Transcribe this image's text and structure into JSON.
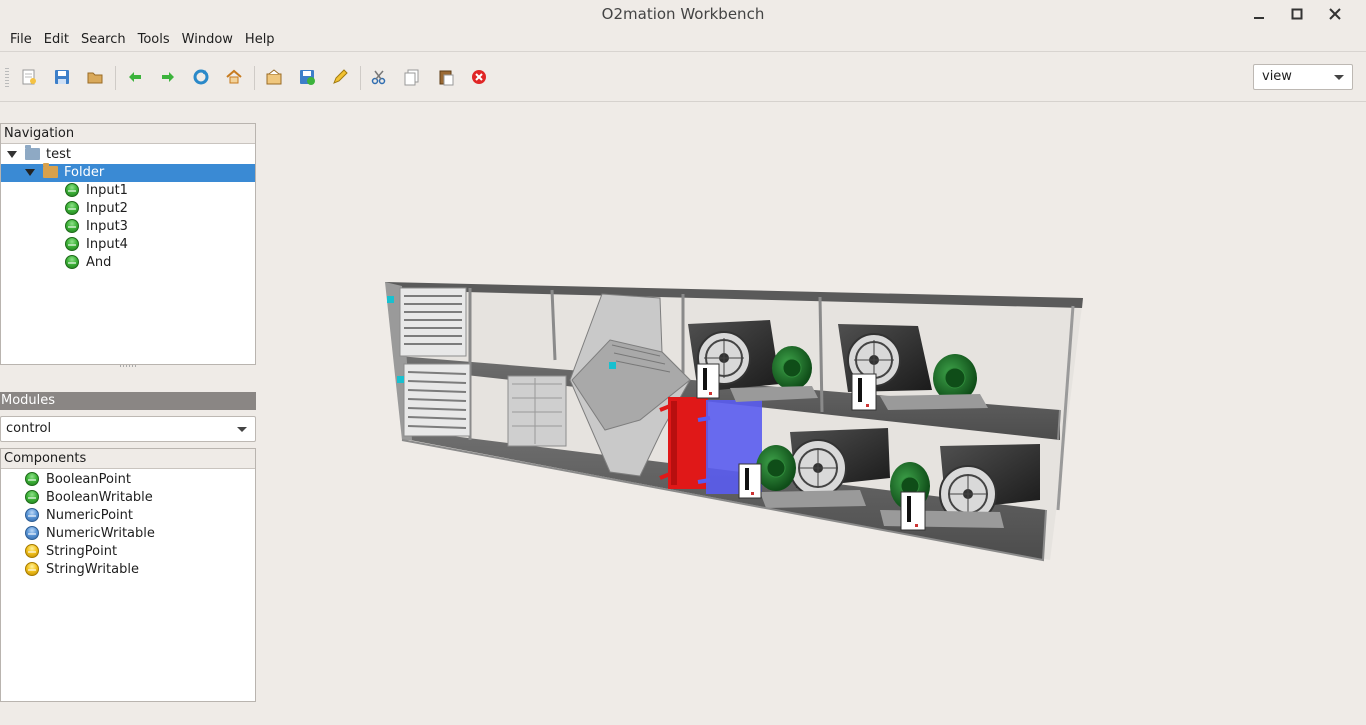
{
  "window": {
    "title": "O2mation Workbench"
  },
  "menu": [
    {
      "label": "File"
    },
    {
      "label": "Edit"
    },
    {
      "label": "Search"
    },
    {
      "label": "Tools"
    },
    {
      "label": "Window"
    },
    {
      "label": "Help"
    }
  ],
  "toolbar": {
    "icons": [
      "new-icon",
      "save-icon",
      "open-icon",
      "back-icon",
      "forward-icon",
      "refresh-icon",
      "home-icon",
      "inbox-icon",
      "save-as-icon",
      "edit-icon",
      "cut-icon",
      "copy-icon",
      "paste-icon",
      "stop-icon"
    ],
    "view_select": {
      "value": "view"
    }
  },
  "navigation": {
    "header": "Navigation",
    "root": {
      "label": "test"
    },
    "folder": {
      "label": "Folder"
    },
    "items": [
      {
        "label": "Input1"
      },
      {
        "label": "Input2"
      },
      {
        "label": "Input3"
      },
      {
        "label": "Input4"
      },
      {
        "label": "And"
      }
    ]
  },
  "modules": {
    "header": "Modules",
    "selected": "control"
  },
  "components": {
    "header": "Components",
    "items": [
      {
        "label": "BooleanPoint",
        "color": "green"
      },
      {
        "label": "BooleanWritable",
        "color": "green"
      },
      {
        "label": "NumericPoint",
        "color": "blue"
      },
      {
        "label": "NumericWritable",
        "color": "blue"
      },
      {
        "label": "StringPoint",
        "color": "yellow"
      },
      {
        "label": "StringWritable",
        "color": "yellow"
      }
    ]
  },
  "colors": {
    "selection": "#3a8ad4",
    "heater": "#e01818",
    "cooler": "#5a5cf0",
    "motor": "#1f7a2a"
  }
}
